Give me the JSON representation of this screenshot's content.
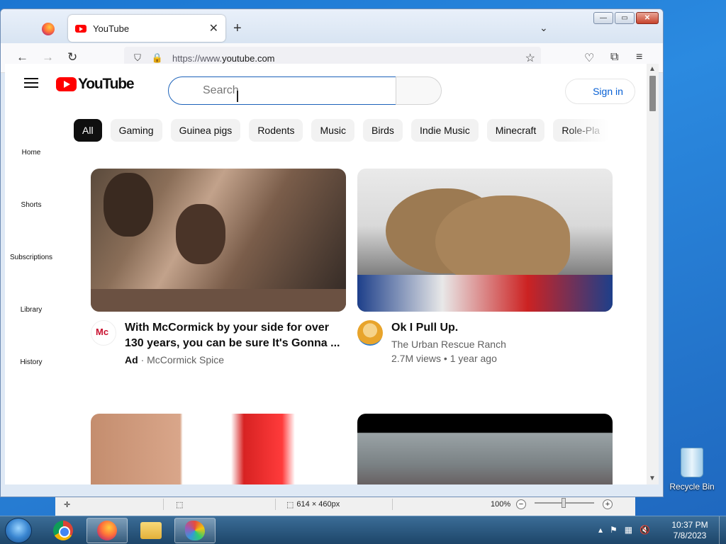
{
  "browser": {
    "tab_title": "YouTube",
    "tab_close": "✕",
    "new_tab": "+",
    "tab_list": "⌄",
    "window_buttons": {
      "minimize": "—",
      "maximize": "▭",
      "close": "✕"
    },
    "url_prefix": "https://www.",
    "url_domain": "youtube.com",
    "nav": {
      "back": "←",
      "forward": "→",
      "reload": "↻"
    }
  },
  "youtube": {
    "logo_text": "YouTube",
    "search_placeholder": "Search",
    "sign_in": "Sign in",
    "chips": [
      "All",
      "Gaming",
      "Guinea pigs",
      "Rodents",
      "Music",
      "Birds",
      "Indie Music",
      "Minecraft",
      "Role-Pla"
    ],
    "sidebar": [
      "Home",
      "Shorts",
      "Subscriptions",
      "Library",
      "History"
    ],
    "videos": [
      {
        "title": "With McCormick by your side for over 130 years, you can be sure It's Gonna ...",
        "badge": "Ad",
        "separator": "·",
        "channel": "McCormick Spice"
      },
      {
        "title": "Ok I Pull Up.",
        "channel": "The Urban Rescue Ranch",
        "views": "2.7M views",
        "separator": "•",
        "age": "1 year ago"
      }
    ]
  },
  "paint": {
    "canvas_size": "614 × 460px",
    "zoom": "100%"
  },
  "desktop": {
    "recycle_bin": "Recycle Bin"
  },
  "taskbar": {
    "time": "10:37 PM",
    "date": "7/8/2023"
  },
  "colors": {
    "youtube_red": "#ff0000",
    "link_blue": "#065fd4",
    "search_focus": "#1c62b9"
  }
}
